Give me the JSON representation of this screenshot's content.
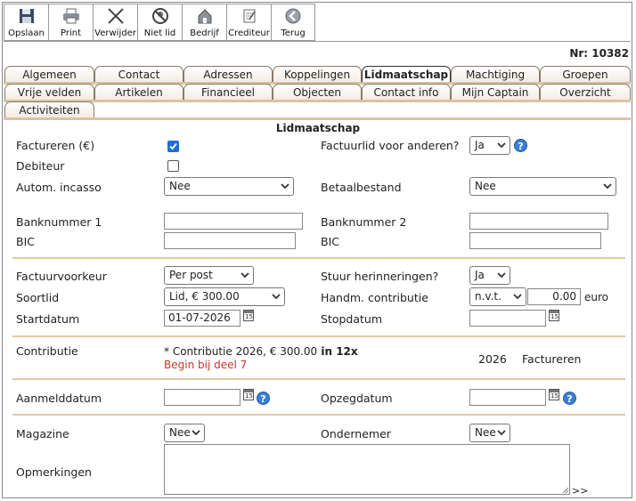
{
  "toolbar": {
    "buttons": [
      {
        "label": "Opslaan",
        "icon": "floppy-disk-icon"
      },
      {
        "label": "Print",
        "icon": "printer-icon"
      },
      {
        "label": "Verwijder",
        "icon": "x-icon"
      },
      {
        "label": "Niet lid",
        "icon": "no-member-icon"
      },
      {
        "label": "Bedrijf",
        "icon": "house-icon"
      },
      {
        "label": "Crediteur",
        "icon": "document-icon"
      },
      {
        "label": "Terug",
        "icon": "back-arrow-icon"
      }
    ]
  },
  "record": {
    "number_label": "Nr: 10382"
  },
  "tabs": {
    "row1": [
      "Algemeen",
      "Contact",
      "Adressen",
      "Koppelingen",
      "Lidmaatschap",
      "Machtiging",
      "Groepen"
    ],
    "row2": [
      "Vrije velden",
      "Artikelen",
      "Financieel",
      "Objecten",
      "Contact info",
      "Mijn Captain",
      "Overzicht"
    ],
    "row3": [
      "Activiteiten"
    ],
    "active": "Lidmaatschap"
  },
  "section": {
    "title": "Lidmaatschap"
  },
  "form": {
    "factureren_label": "Factureren (€)",
    "factuurlid_label": "Factuurlid voor anderen?",
    "factuurlid_value": "Ja",
    "debiteur_label": "Debiteur",
    "incasso_label": "Autom. incasso",
    "incasso_value": "Nee",
    "betaalbestand_label": "Betaalbestand",
    "betaalbestand_value": "Nee",
    "banknummer1_label": "Banknummer 1",
    "banknummer1_value": "",
    "banknummer2_label": "Banknummer 2",
    "banknummer2_value": "",
    "bic1_label": "BIC",
    "bic1_value": "",
    "bic2_label": "BIC",
    "bic2_value": "",
    "factuurvoorkeur_label": "Factuurvoorkeur",
    "factuurvoorkeur_value": "Per post",
    "herinneringen_label": "Stuur herinneringen?",
    "herinneringen_value": "Ja",
    "soortlid_label": "Soortlid",
    "soortlid_value": "Lid, € 300.00",
    "handm_label": "Handm. contributie",
    "handm_select": "n.v.t.",
    "handm_amount": "0.00",
    "handm_unit": "euro",
    "startdatum_label": "Startdatum",
    "startdatum_value": "01-07-2026",
    "stopdatum_label": "Stopdatum",
    "stopdatum_value": "",
    "contributie_label": "Contributie",
    "contributie_line": "* Contributie 2026, € 300.00",
    "contributie_bold": " in 12x",
    "contributie_begin": "Begin bij deel 7",
    "contributie_year": "2026",
    "contributie_action": "Factureren",
    "aanmelddatum_label": "Aanmelddatum",
    "aanmelddatum_value": "",
    "opzegdatum_label": "Opzegdatum",
    "opzegdatum_value": "",
    "magazine_label": "Magazine",
    "magazine_value": "Nee",
    "ondernemer_label": "Ondernemer",
    "ondernemer_value": "Nee",
    "opmerkingen_label": "Opmerkingen",
    "opmerkingen_value": "",
    "more_label": ">>"
  },
  "colors": {
    "accent_line": "#e2c8a5",
    "checkbox_on": "#1f6fd6",
    "help_icon": "#3a7fd4",
    "begin_text": "#c0392b"
  }
}
